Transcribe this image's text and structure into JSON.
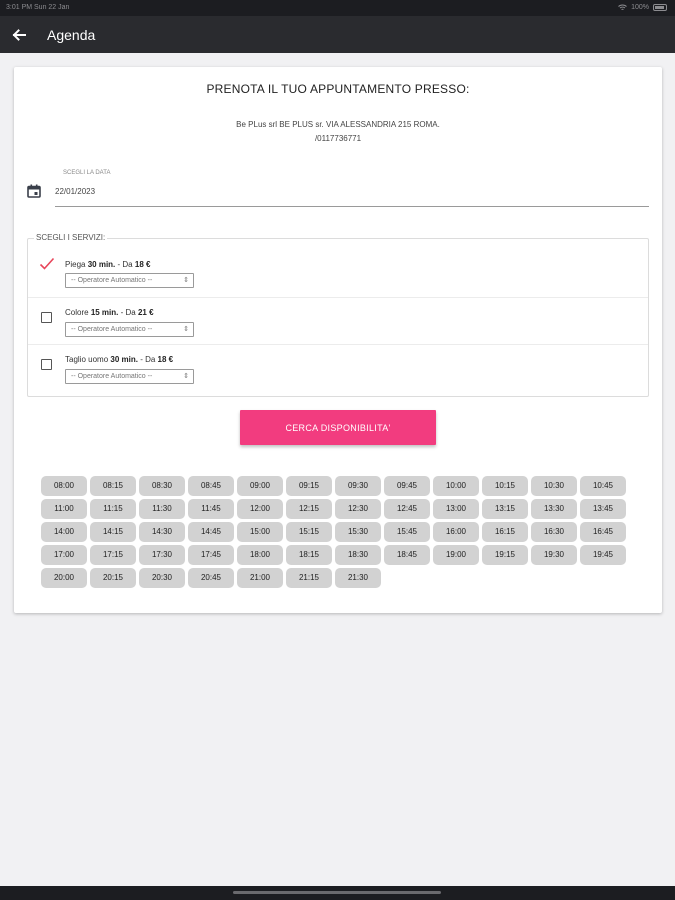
{
  "status_bar": {
    "left_text": "3:01 PM  Sun 22 Jan",
    "right_text": "100%"
  },
  "app_bar": {
    "back_icon": "arrow-back-icon",
    "title": "Agenda"
  },
  "booking": {
    "heading": "PRENOTA IL TUO APPUNTAMENTO PRESSO:",
    "address_line1": "Be PLus srl BE PLUS sr. VIA ALESSANDRIA 215 ROMA.",
    "address_line2": "/0117736771"
  },
  "date": {
    "icon": "calendar-icon",
    "label": "SCEGLI LA DATA",
    "value": "22/01/2023"
  },
  "services": {
    "legend": "SCEGLI I SERVIZI:",
    "items": [
      {
        "name": "Piega",
        "duration": "30 min.",
        "price_prefix": "- Da",
        "price": "18 €",
        "checked": true,
        "operator": "-- Operatore Automatico --"
      },
      {
        "name": "Colore",
        "duration": "15 min.",
        "price_prefix": "- Da",
        "price": "21 €",
        "checked": false,
        "operator": "-- Operatore Automatico --"
      },
      {
        "name": "Taglio uomo",
        "duration": "30 min.",
        "price_prefix": "- Da",
        "price": "18 €",
        "checked": false,
        "operator": "-- Operatore Automatico --"
      }
    ],
    "select_arrows": "⇕"
  },
  "search_button": {
    "label": "CERCA DISPONIBILITA'"
  },
  "time_slots": [
    "08:00",
    "08:15",
    "08:30",
    "08:45",
    "09:00",
    "09:15",
    "09:30",
    "09:45",
    "10:00",
    "10:15",
    "10:30",
    "10:45",
    "11:00",
    "11:15",
    "11:30",
    "11:45",
    "12:00",
    "12:15",
    "12:30",
    "12:45",
    "13:00",
    "13:15",
    "13:30",
    "13:45",
    "14:00",
    "14:15",
    "14:30",
    "14:45",
    "15:00",
    "15:15",
    "15:30",
    "15:45",
    "16:00",
    "16:15",
    "16:30",
    "16:45",
    "17:00",
    "17:15",
    "17:30",
    "17:45",
    "18:00",
    "18:15",
    "18:30",
    "18:45",
    "19:00",
    "19:15",
    "19:30",
    "19:45",
    "20:00",
    "20:15",
    "20:30",
    "20:45",
    "21:00",
    "21:15",
    "21:30"
  ],
  "colors": {
    "accent": "#f23c7f",
    "app_bar": "#2a2b2f",
    "slot_bg": "#d2d2d2",
    "check_mark": "#e8455a"
  }
}
